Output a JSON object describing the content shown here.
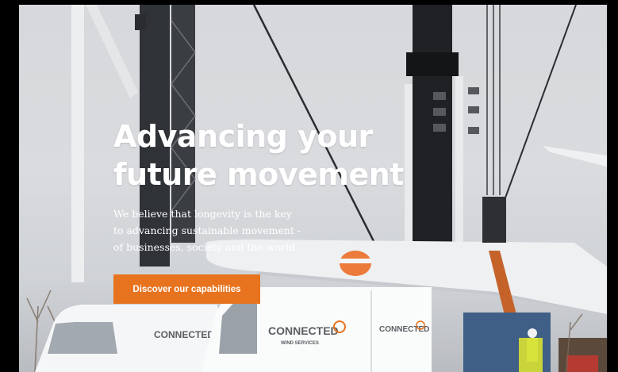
{
  "hero": {
    "headline": [
      "Advancing your",
      "future movement"
    ],
    "subtext": [
      "We believe that longevity is the key",
      "to advancing sustainable movement -",
      "of businesses, society and the world."
    ],
    "cta_label": "Discover our capabilities"
  },
  "vans": {
    "logo_text": "CONNECTED",
    "logo_subtext": "WIND SERVICES"
  },
  "colors": {
    "accent": "#e8731e",
    "headline": "#ffffff",
    "sky": "#d8dadd"
  }
}
